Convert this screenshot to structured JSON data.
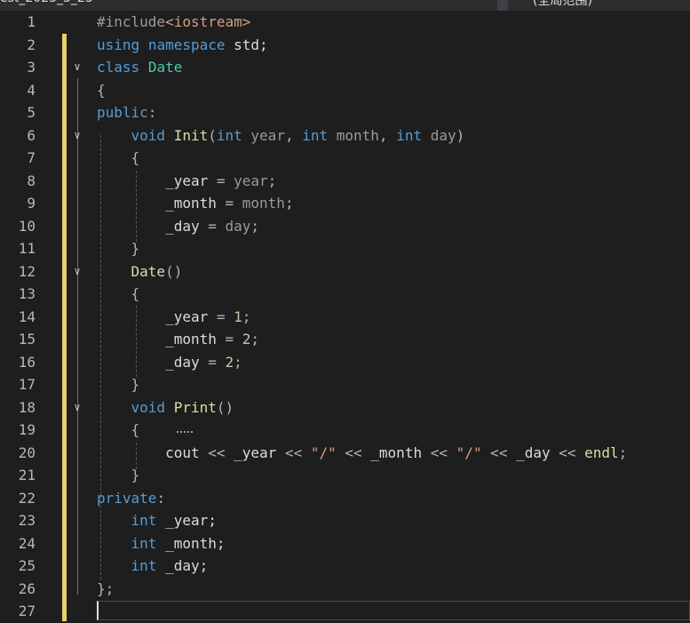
{
  "window": {
    "tab_left": "est_2023_3_23",
    "tab_right": "(全局范围)"
  },
  "editor": {
    "lines": [
      {
        "n": "1",
        "t": [
          [
            "pre",
            "#include"
          ],
          [
            "inc",
            "<iostream>"
          ]
        ]
      },
      {
        "n": "2",
        "t": [
          [
            "kw",
            "using"
          ],
          [
            "id",
            " "
          ],
          [
            "kw",
            "namespace"
          ],
          [
            "id",
            " std;"
          ]
        ]
      },
      {
        "n": "3",
        "t": [
          [
            "kw",
            "class"
          ],
          [
            "id",
            " "
          ],
          [
            "type",
            "Date"
          ]
        ]
      },
      {
        "n": "4",
        "t": [
          [
            "punc",
            "{"
          ]
        ]
      },
      {
        "n": "5",
        "t": [
          [
            "kw",
            "public"
          ],
          [
            "punc",
            ":"
          ]
        ]
      },
      {
        "n": "6",
        "t": [
          [
            "id",
            "    "
          ],
          [
            "kw",
            "void"
          ],
          [
            "id",
            " "
          ],
          [
            "fn",
            "Init"
          ],
          [
            "punc",
            "("
          ],
          [
            "kw",
            "int"
          ],
          [
            "param",
            " year"
          ],
          [
            "punc",
            ", "
          ],
          [
            "kw",
            "int"
          ],
          [
            "param",
            " month"
          ],
          [
            "punc",
            ", "
          ],
          [
            "kw",
            "int"
          ],
          [
            "param",
            " day"
          ],
          [
            "punc",
            ")"
          ]
        ]
      },
      {
        "n": "7",
        "t": [
          [
            "id",
            "    "
          ],
          [
            "punc",
            "{"
          ]
        ]
      },
      {
        "n": "8",
        "t": [
          [
            "id",
            "        _year "
          ],
          [
            "punc",
            "= "
          ],
          [
            "param",
            "year"
          ],
          [
            "punc",
            ";"
          ]
        ]
      },
      {
        "n": "9",
        "t": [
          [
            "id",
            "        _month "
          ],
          [
            "punc",
            "= "
          ],
          [
            "param",
            "month"
          ],
          [
            "punc",
            ";"
          ]
        ]
      },
      {
        "n": "10",
        "t": [
          [
            "id",
            "        _day "
          ],
          [
            "punc",
            "= "
          ],
          [
            "param",
            "day"
          ],
          [
            "punc",
            ";"
          ]
        ]
      },
      {
        "n": "11",
        "t": [
          [
            "id",
            "    "
          ],
          [
            "punc",
            "}"
          ]
        ]
      },
      {
        "n": "12",
        "t": [
          [
            "id",
            "    "
          ],
          [
            "fn",
            "Date"
          ],
          [
            "punc",
            "()"
          ]
        ]
      },
      {
        "n": "13",
        "t": [
          [
            "id",
            "    "
          ],
          [
            "punc",
            "{"
          ]
        ]
      },
      {
        "n": "14",
        "t": [
          [
            "id",
            "        _year "
          ],
          [
            "punc",
            "= "
          ],
          [
            "num",
            "1"
          ],
          [
            "punc",
            ";"
          ]
        ]
      },
      {
        "n": "15",
        "t": [
          [
            "id",
            "        _month "
          ],
          [
            "punc",
            "= "
          ],
          [
            "num",
            "2"
          ],
          [
            "punc",
            ";"
          ]
        ]
      },
      {
        "n": "16",
        "t": [
          [
            "id",
            "        _day "
          ],
          [
            "punc",
            "= "
          ],
          [
            "num",
            "2"
          ],
          [
            "punc",
            ";"
          ]
        ]
      },
      {
        "n": "17",
        "t": [
          [
            "id",
            "    "
          ],
          [
            "punc",
            "}"
          ]
        ]
      },
      {
        "n": "18",
        "t": [
          [
            "id",
            "    "
          ],
          [
            "kw",
            "void"
          ],
          [
            "id",
            " "
          ],
          [
            "fn",
            "Print"
          ],
          [
            "punc",
            "()"
          ]
        ]
      },
      {
        "n": "19",
        "t": [
          [
            "id",
            "    "
          ],
          [
            "punc",
            "{"
          ]
        ]
      },
      {
        "n": "20",
        "t": [
          [
            "id",
            "        cout "
          ],
          [
            "punc",
            "<< "
          ],
          [
            "id",
            "_year "
          ],
          [
            "punc",
            "<< "
          ],
          [
            "str",
            "\"/\""
          ],
          [
            "punc",
            " << "
          ],
          [
            "id",
            "_month "
          ],
          [
            "punc",
            "<< "
          ],
          [
            "str",
            "\"/\""
          ],
          [
            "punc",
            " << "
          ],
          [
            "id",
            "_day "
          ],
          [
            "punc",
            "<< "
          ],
          [
            "fn",
            "endl"
          ],
          [
            "punc",
            ";"
          ]
        ]
      },
      {
        "n": "21",
        "t": [
          [
            "id",
            "    "
          ],
          [
            "punc",
            "}"
          ]
        ]
      },
      {
        "n": "22",
        "t": [
          [
            "kw",
            "private"
          ],
          [
            "punc",
            ":"
          ]
        ]
      },
      {
        "n": "23",
        "t": [
          [
            "id",
            "    "
          ],
          [
            "kw",
            "int"
          ],
          [
            "id",
            " _year;"
          ]
        ]
      },
      {
        "n": "24",
        "t": [
          [
            "id",
            "    "
          ],
          [
            "kw",
            "int"
          ],
          [
            "id",
            " _month;"
          ]
        ]
      },
      {
        "n": "25",
        "t": [
          [
            "id",
            "    "
          ],
          [
            "kw",
            "int"
          ],
          [
            "id",
            " _day;"
          ]
        ]
      },
      {
        "n": "26",
        "t": [
          [
            "punc",
            "};"
          ]
        ]
      },
      {
        "n": "27",
        "t": []
      }
    ],
    "fold_lines": [
      "3",
      "6",
      "12",
      "18"
    ],
    "fold_glyph": "∨"
  },
  "colors": {
    "background": "#1e1e1e",
    "keyword": "#569cd6",
    "type": "#4ec9b0",
    "function": "#dcdcaa",
    "number": "#b5cea8",
    "string": "#d69d85",
    "change_margin": "#e8d06e"
  }
}
